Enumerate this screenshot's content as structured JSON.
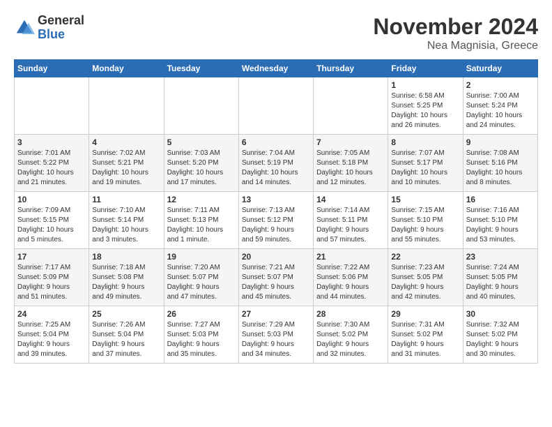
{
  "header": {
    "logo_line1": "General",
    "logo_line2": "Blue",
    "month": "November 2024",
    "location": "Nea Magnisia, Greece"
  },
  "weekdays": [
    "Sunday",
    "Monday",
    "Tuesday",
    "Wednesday",
    "Thursday",
    "Friday",
    "Saturday"
  ],
  "weeks": [
    [
      {
        "day": "",
        "detail": ""
      },
      {
        "day": "",
        "detail": ""
      },
      {
        "day": "",
        "detail": ""
      },
      {
        "day": "",
        "detail": ""
      },
      {
        "day": "",
        "detail": ""
      },
      {
        "day": "1",
        "detail": "Sunrise: 6:58 AM\nSunset: 5:25 PM\nDaylight: 10 hours\nand 26 minutes."
      },
      {
        "day": "2",
        "detail": "Sunrise: 7:00 AM\nSunset: 5:24 PM\nDaylight: 10 hours\nand 24 minutes."
      }
    ],
    [
      {
        "day": "3",
        "detail": "Sunrise: 7:01 AM\nSunset: 5:22 PM\nDaylight: 10 hours\nand 21 minutes."
      },
      {
        "day": "4",
        "detail": "Sunrise: 7:02 AM\nSunset: 5:21 PM\nDaylight: 10 hours\nand 19 minutes."
      },
      {
        "day": "5",
        "detail": "Sunrise: 7:03 AM\nSunset: 5:20 PM\nDaylight: 10 hours\nand 17 minutes."
      },
      {
        "day": "6",
        "detail": "Sunrise: 7:04 AM\nSunset: 5:19 PM\nDaylight: 10 hours\nand 14 minutes."
      },
      {
        "day": "7",
        "detail": "Sunrise: 7:05 AM\nSunset: 5:18 PM\nDaylight: 10 hours\nand 12 minutes."
      },
      {
        "day": "8",
        "detail": "Sunrise: 7:07 AM\nSunset: 5:17 PM\nDaylight: 10 hours\nand 10 minutes."
      },
      {
        "day": "9",
        "detail": "Sunrise: 7:08 AM\nSunset: 5:16 PM\nDaylight: 10 hours\nand 8 minutes."
      }
    ],
    [
      {
        "day": "10",
        "detail": "Sunrise: 7:09 AM\nSunset: 5:15 PM\nDaylight: 10 hours\nand 5 minutes."
      },
      {
        "day": "11",
        "detail": "Sunrise: 7:10 AM\nSunset: 5:14 PM\nDaylight: 10 hours\nand 3 minutes."
      },
      {
        "day": "12",
        "detail": "Sunrise: 7:11 AM\nSunset: 5:13 PM\nDaylight: 10 hours\nand 1 minute."
      },
      {
        "day": "13",
        "detail": "Sunrise: 7:13 AM\nSunset: 5:12 PM\nDaylight: 9 hours\nand 59 minutes."
      },
      {
        "day": "14",
        "detail": "Sunrise: 7:14 AM\nSunset: 5:11 PM\nDaylight: 9 hours\nand 57 minutes."
      },
      {
        "day": "15",
        "detail": "Sunrise: 7:15 AM\nSunset: 5:10 PM\nDaylight: 9 hours\nand 55 minutes."
      },
      {
        "day": "16",
        "detail": "Sunrise: 7:16 AM\nSunset: 5:10 PM\nDaylight: 9 hours\nand 53 minutes."
      }
    ],
    [
      {
        "day": "17",
        "detail": "Sunrise: 7:17 AM\nSunset: 5:09 PM\nDaylight: 9 hours\nand 51 minutes."
      },
      {
        "day": "18",
        "detail": "Sunrise: 7:18 AM\nSunset: 5:08 PM\nDaylight: 9 hours\nand 49 minutes."
      },
      {
        "day": "19",
        "detail": "Sunrise: 7:20 AM\nSunset: 5:07 PM\nDaylight: 9 hours\nand 47 minutes."
      },
      {
        "day": "20",
        "detail": "Sunrise: 7:21 AM\nSunset: 5:07 PM\nDaylight: 9 hours\nand 45 minutes."
      },
      {
        "day": "21",
        "detail": "Sunrise: 7:22 AM\nSunset: 5:06 PM\nDaylight: 9 hours\nand 44 minutes."
      },
      {
        "day": "22",
        "detail": "Sunrise: 7:23 AM\nSunset: 5:05 PM\nDaylight: 9 hours\nand 42 minutes."
      },
      {
        "day": "23",
        "detail": "Sunrise: 7:24 AM\nSunset: 5:05 PM\nDaylight: 9 hours\nand 40 minutes."
      }
    ],
    [
      {
        "day": "24",
        "detail": "Sunrise: 7:25 AM\nSunset: 5:04 PM\nDaylight: 9 hours\nand 39 minutes."
      },
      {
        "day": "25",
        "detail": "Sunrise: 7:26 AM\nSunset: 5:04 PM\nDaylight: 9 hours\nand 37 minutes."
      },
      {
        "day": "26",
        "detail": "Sunrise: 7:27 AM\nSunset: 5:03 PM\nDaylight: 9 hours\nand 35 minutes."
      },
      {
        "day": "27",
        "detail": "Sunrise: 7:29 AM\nSunset: 5:03 PM\nDaylight: 9 hours\nand 34 minutes."
      },
      {
        "day": "28",
        "detail": "Sunrise: 7:30 AM\nSunset: 5:02 PM\nDaylight: 9 hours\nand 32 minutes."
      },
      {
        "day": "29",
        "detail": "Sunrise: 7:31 AM\nSunset: 5:02 PM\nDaylight: 9 hours\nand 31 minutes."
      },
      {
        "day": "30",
        "detail": "Sunrise: 7:32 AM\nSunset: 5:02 PM\nDaylight: 9 hours\nand 30 minutes."
      }
    ]
  ]
}
